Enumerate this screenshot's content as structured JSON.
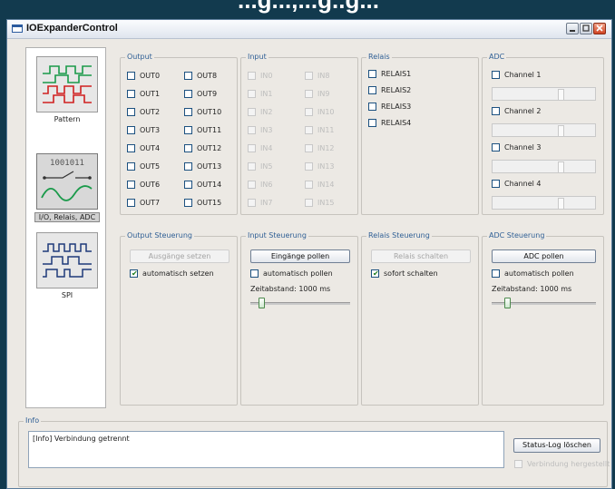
{
  "banner": {
    "text": "...g...,...g..g..."
  },
  "window": {
    "title": "IOExpanderControl"
  },
  "sidebar": {
    "items": [
      {
        "label": "Pattern",
        "icon": "pattern-waveform-icon",
        "selected": false
      },
      {
        "label": "I/O, Relais, ADC",
        "icon": "io-relay-adc-icon",
        "selected": true
      },
      {
        "label": "SPI",
        "icon": "spi-waveform-icon",
        "selected": false
      }
    ]
  },
  "output": {
    "title": "Output",
    "col1": [
      "OUT0",
      "OUT1",
      "OUT2",
      "OUT3",
      "OUT4",
      "OUT5",
      "OUT6",
      "OUT7"
    ],
    "col2": [
      "OUT8",
      "OUT9",
      "OUT10",
      "OUT11",
      "OUT12",
      "OUT13",
      "OUT14",
      "OUT15"
    ]
  },
  "input": {
    "title": "Input",
    "col1": [
      "IN0",
      "IN1",
      "IN2",
      "IN3",
      "IN4",
      "IN5",
      "IN6",
      "IN7"
    ],
    "col2": [
      "IN8",
      "IN9",
      "IN10",
      "IN11",
      "IN12",
      "IN13",
      "IN14",
      "IN15"
    ]
  },
  "relais": {
    "title": "Relais",
    "items": [
      "RELAIS1",
      "RELAIS2",
      "RELAIS3",
      "RELAIS4"
    ]
  },
  "adc": {
    "title": "ADC",
    "channels": [
      "Channel 1",
      "Channel 2",
      "Channel 3",
      "Channel 4"
    ]
  },
  "output_steuerung": {
    "title": "Output Steuerung",
    "button": "Ausgänge setzen",
    "checkbox": "automatisch setzen",
    "checked": true
  },
  "input_steuerung": {
    "title": "Input Steuerung",
    "button": "Eingänge pollen",
    "checkbox": "automatisch pollen",
    "checked": false,
    "interval_label": "Zeitabstand: 1000 ms"
  },
  "relais_steuerung": {
    "title": "Relais Steuerung",
    "button": "Relais schalten",
    "checkbox": "sofort schalten",
    "checked": true
  },
  "adc_steuerung": {
    "title": "ADC Steuerung",
    "button": "ADC pollen",
    "checkbox": "automatisch pollen",
    "checked": false,
    "interval_label": "Zeitabstand: 1000 ms"
  },
  "info": {
    "title": "Info",
    "log": "[Info] Verbindung getrennt",
    "clear_button": "Status-Log löschen",
    "connected_label": "Verbindung hergestellt",
    "connected": false
  },
  "colors": {
    "group_title": "#2f5f95",
    "check": "#1a7a1a",
    "titlebar_close": "#d04423"
  }
}
